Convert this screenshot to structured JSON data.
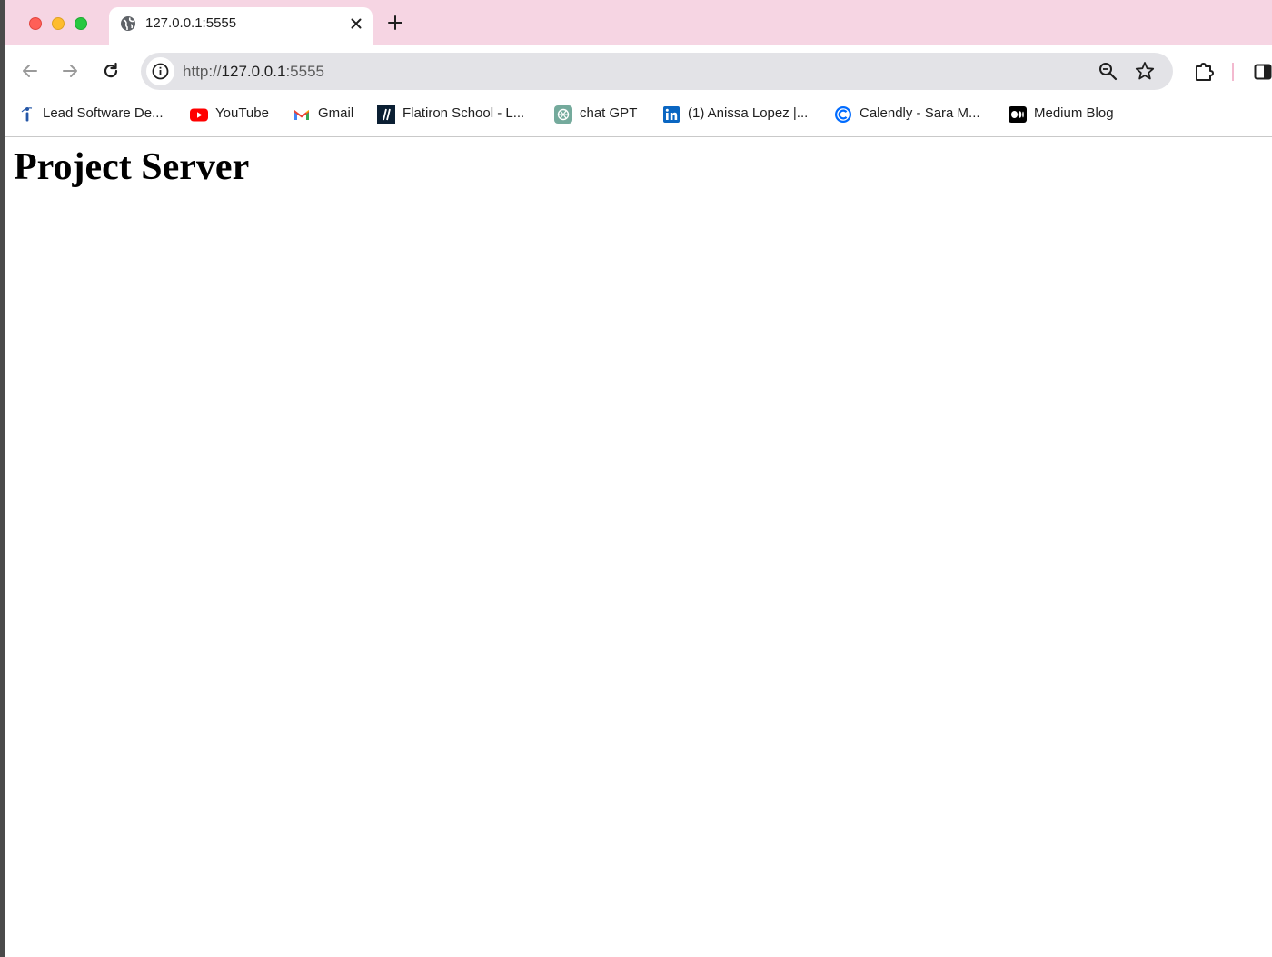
{
  "browser": {
    "tab": {
      "title": "127.0.0.1:5555",
      "icon": "globe-icon"
    },
    "omnibox": {
      "url_scheme": "http://",
      "url_host": "127.0.0.1",
      "url_port": ":5555"
    },
    "bookmarks": [
      {
        "label": "Lead Software De...",
        "icon": "indeed-icon"
      },
      {
        "label": "YouTube",
        "icon": "youtube-icon"
      },
      {
        "label": "Gmail",
        "icon": "gmail-icon"
      },
      {
        "label": "Flatiron School - L...",
        "icon": "flatiron-icon"
      },
      {
        "label": "chat GPT",
        "icon": "chatgpt-icon"
      },
      {
        "label": "(1) Anissa Lopez |...",
        "icon": "linkedin-icon"
      },
      {
        "label": "Calendly - Sara M...",
        "icon": "calendly-icon"
      },
      {
        "label": "Medium Blog",
        "icon": "medium-icon"
      }
    ],
    "colors": {
      "tabstrip": "#f6d5e3",
      "omnibox": "#e3e3e7"
    }
  },
  "page": {
    "heading": "Project Server"
  }
}
